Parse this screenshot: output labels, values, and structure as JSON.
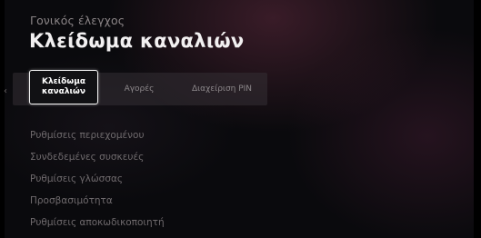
{
  "header": {
    "breadcrumb": "Γονικός έλεγχος",
    "title": "Κλείδωμα καναλιών"
  },
  "tabs": [
    {
      "label": "Κλείδωμα καναλιών",
      "active": true
    },
    {
      "label": "Αγορές",
      "active": false
    },
    {
      "label": "Διαχείριση PIN",
      "active": false
    }
  ],
  "nav": {
    "left_arrow_icon": "chevron-left-icon"
  },
  "menu": [
    {
      "label": "Ρυθμίσεις περιεχομένου"
    },
    {
      "label": "Συνδεδεμένες συσκευές"
    },
    {
      "label": "Ρυθμίσεις γλώσσας"
    },
    {
      "label": "Προσβασιμότητα"
    },
    {
      "label": "Ρυθμίσεις αποκωδικοποιητή"
    }
  ],
  "colors": {
    "accent": "#ffffff",
    "background": "#0a0a0d",
    "muted_text": "#6f6a6d"
  }
}
